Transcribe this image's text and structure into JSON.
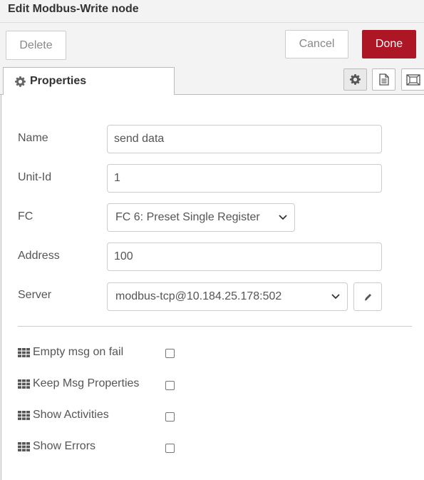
{
  "dialog": {
    "title": "Edit Modbus-Write node",
    "delete_label": "Delete",
    "cancel_label": "Cancel",
    "done_label": "Done"
  },
  "tabs": {
    "properties_label": "Properties",
    "side_icons": [
      "gear-icon",
      "document-icon",
      "appearance-icon"
    ]
  },
  "form": {
    "name_label": "Name",
    "name_value": "send data",
    "unitid_label": "Unit-Id",
    "unitid_value": "1",
    "fc_label": "FC",
    "fc_value": "FC 6: Preset Single Register",
    "address_label": "Address",
    "address_value": "100",
    "server_label": "Server",
    "server_value": "modbus-tcp@10.184.25.178:502"
  },
  "options": {
    "empty_msg_label": "Empty msg on fail",
    "keep_msg_label": "Keep Msg Properties",
    "show_activities_label": "Show Activities",
    "show_errors_label": "Show Errors",
    "empty_msg_checked": false,
    "keep_msg_checked": false,
    "show_activities_checked": false,
    "show_errors_checked": false
  },
  "colors": {
    "done_bg": "#ad1625",
    "panel_bg": "#ffffff",
    "chrome_bg": "#f3f3f3"
  }
}
